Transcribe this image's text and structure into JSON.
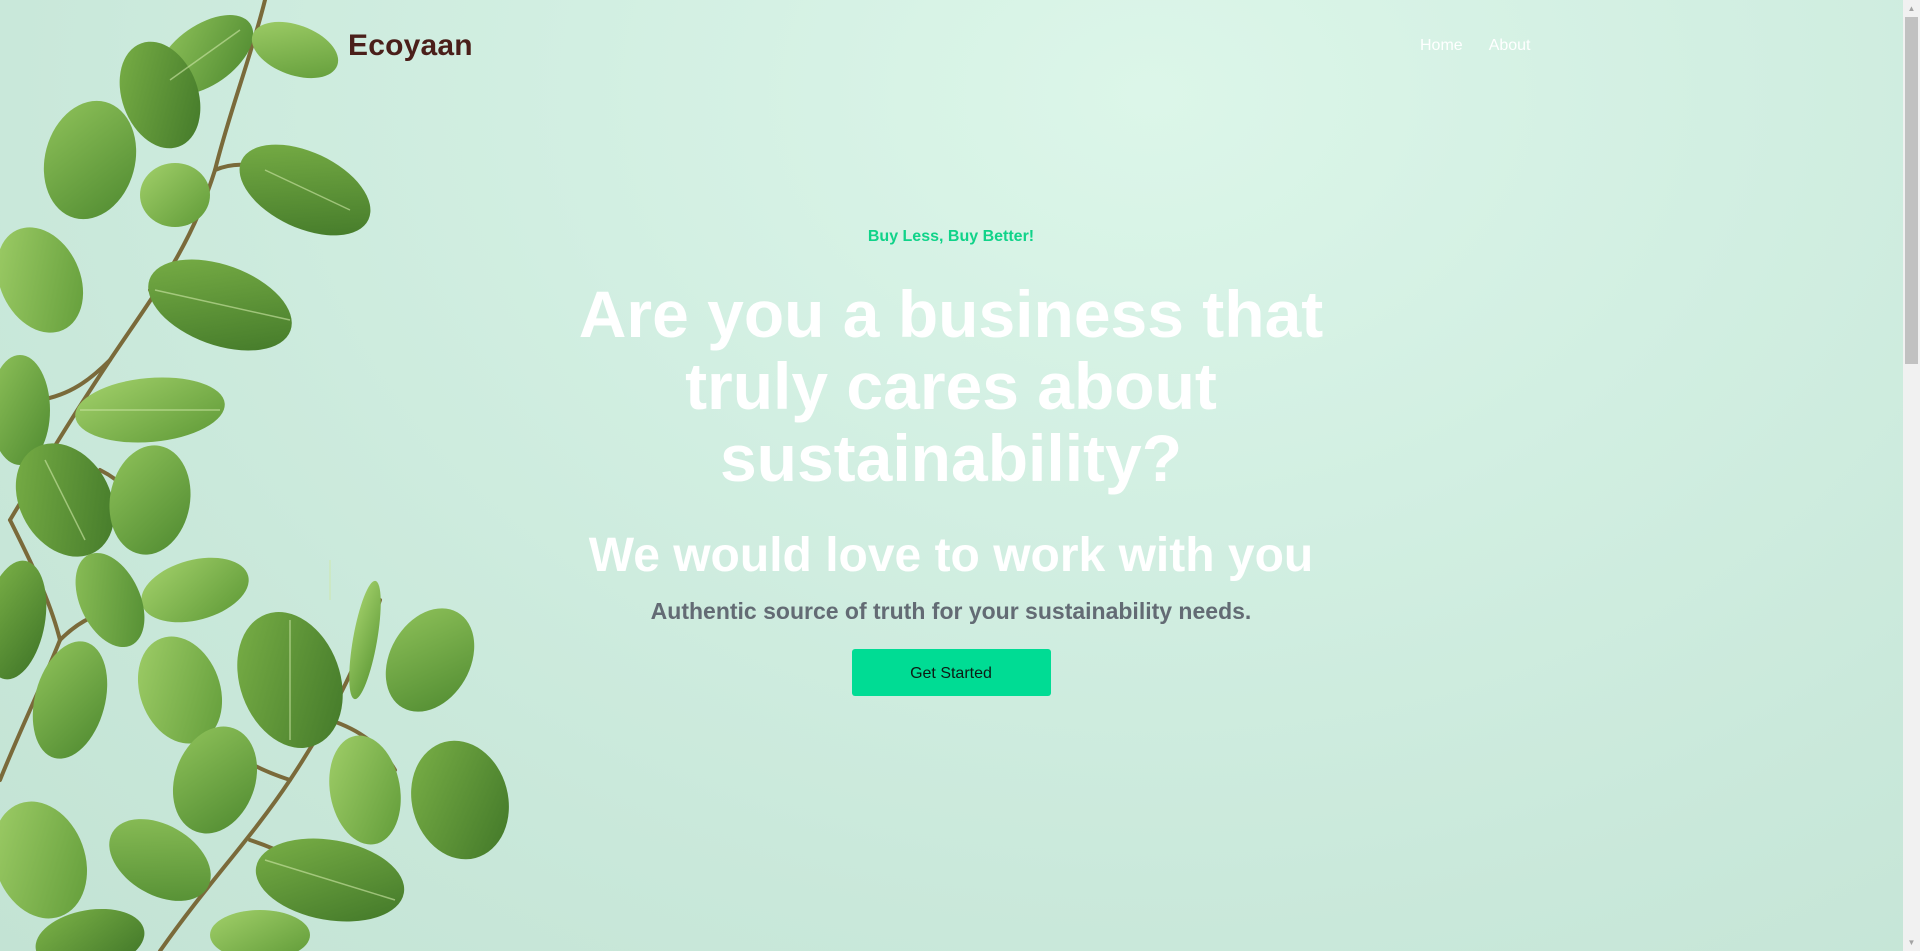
{
  "nav": {
    "brand": "Ecoyaan",
    "links": [
      "Home",
      "About"
    ]
  },
  "hero": {
    "tagline": "Buy Less, Buy Better!",
    "headline": "Are you a business that truly cares about sustainability?",
    "subheadline": "We would love to work with you",
    "description": "Authentic source of truth for your sustainability needs.",
    "cta_label": "Get Started"
  },
  "colors": {
    "brand": "#4a1f1a",
    "accent": "#00dc94",
    "tagline": "#10d389",
    "background": "#d2efe2"
  },
  "icons": {
    "scroll_up": "triangle-up-icon",
    "scroll_down": "triangle-down-icon",
    "decoration": "leaves-branch-illustration"
  }
}
